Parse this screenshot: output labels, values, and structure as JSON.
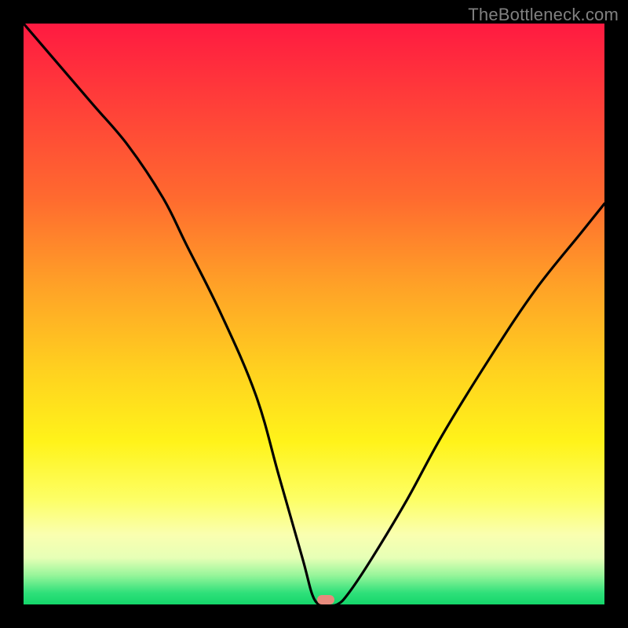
{
  "watermark": "TheBottleneck.com",
  "colors": {
    "frame": "#000000",
    "curve": "#000000",
    "marker": "#e88a7d",
    "gradient_top": "#ff1a41",
    "gradient_bottom": "#14d66a"
  },
  "chart_data": {
    "type": "line",
    "title": "",
    "xlabel": "",
    "ylabel": "",
    "xlim": [
      0,
      100
    ],
    "ylim": [
      0,
      100
    ],
    "grid": false,
    "legend": false,
    "minimum_x": 52,
    "series": [
      {
        "name": "bottleneck-curve",
        "x": [
          0,
          6,
          12,
          18,
          24,
          28,
          34,
          40,
          44,
          48,
          50,
          52,
          54,
          56,
          60,
          66,
          72,
          80,
          88,
          96,
          100
        ],
        "values": [
          100,
          93,
          86,
          79,
          70,
          62,
          50,
          36,
          22,
          8,
          1,
          0,
          0,
          2,
          8,
          18,
          29,
          42,
          54,
          64,
          69
        ]
      }
    ],
    "background_scale": {
      "orientation": "vertical",
      "stops": [
        {
          "pos": 0.0,
          "color": "#ff1a41"
        },
        {
          "pos": 0.3,
          "color": "#ff6a2f"
        },
        {
          "pos": 0.6,
          "color": "#ffd21f"
        },
        {
          "pos": 0.82,
          "color": "#fdff66"
        },
        {
          "pos": 0.95,
          "color": "#96f59a"
        },
        {
          "pos": 1.0,
          "color": "#14d66a"
        }
      ]
    }
  }
}
